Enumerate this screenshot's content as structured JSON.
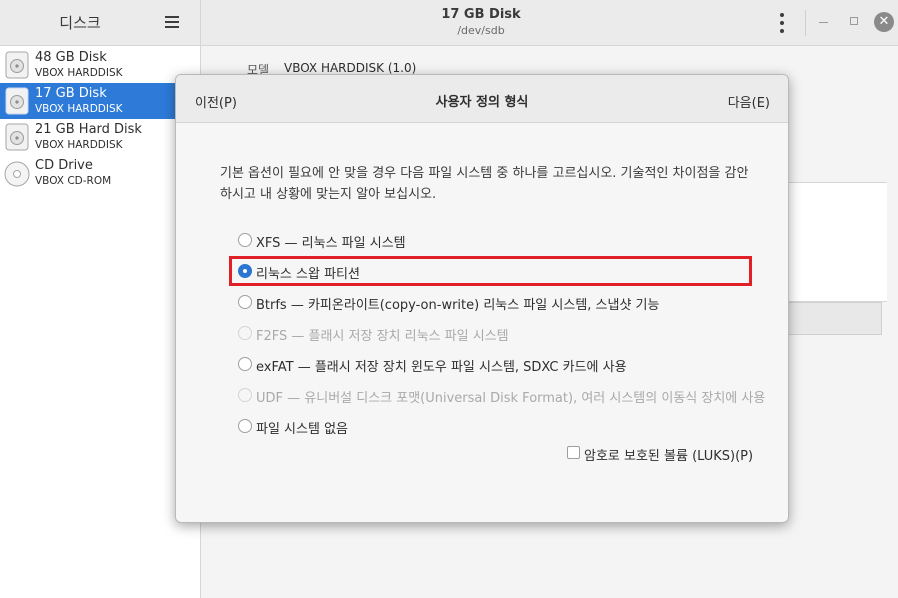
{
  "sidebar": {
    "title": "디스크",
    "items": [
      {
        "name": "48 GB Disk",
        "sub": "VBOX HARDDISK",
        "icon": "hard-disk-icon",
        "selected": false
      },
      {
        "name": "17 GB Disk",
        "sub": "VBOX HARDDISK",
        "icon": "hard-disk-icon",
        "selected": true
      },
      {
        "name": "21 GB Hard Disk",
        "sub": "VBOX HARDDISK",
        "icon": "hard-disk-icon",
        "selected": false
      },
      {
        "name": "CD Drive",
        "sub": "VBOX CD-ROM",
        "icon": "optical-disc-icon",
        "selected": false
      }
    ]
  },
  "main": {
    "title": "17 GB Disk",
    "subtitle": "/dev/sdb",
    "model_label": "모델",
    "model_value": "VBOX HARDDISK (1.0)"
  },
  "dialog": {
    "prev_label": "이전(P)",
    "title": "사용자 정의 형식",
    "next_label": "다음(E)",
    "description": "기본 옵션이 필요에 안 맞을 경우 다음 파일 시스템 중 하나를 고르십시오. 기술적인 차이점을 감안하시고 내 상황에 맞는지 알아 보십시오.",
    "options": [
      {
        "label": "XFS — 리눅스 파일 시스템",
        "checked": false,
        "enabled": true
      },
      {
        "label": "리눅스 스왑 파티션",
        "checked": true,
        "enabled": true
      },
      {
        "label": "Btrfs — 카피온라이트(copy-on-write) 리눅스 파일 시스템, 스냅샷 기능",
        "checked": false,
        "enabled": true
      },
      {
        "label": "F2FS — 플래시 저장 장치 리눅스 파일 시스템",
        "checked": false,
        "enabled": false
      },
      {
        "label": "exFAT — 플래시 저장 장치 윈도우 파일 시스템, SDXC 카드에 사용",
        "checked": false,
        "enabled": true
      },
      {
        "label": "UDF — 유니버설 디스크 포맷(Universal Disk Format), 여러 시스템의 이동식 장치에 사용",
        "checked": false,
        "enabled": false
      },
      {
        "label": "파일 시스템 없음",
        "checked": false,
        "enabled": true
      }
    ],
    "luks_label": "암호로 보호된 볼륨 (LUKS)(P)",
    "luks_checked": false
  },
  "colors": {
    "selection": "#2d7ad8",
    "highlight_box": "#e01f26",
    "radio_checked": "#2a76d2"
  }
}
